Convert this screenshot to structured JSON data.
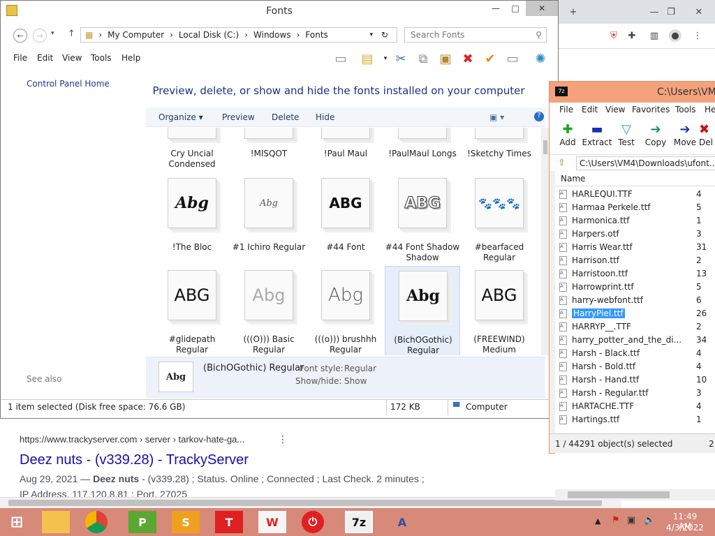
{
  "chrome": {
    "new_tab": "+",
    "minimize": "—",
    "restore": "❐",
    "close": "✕"
  },
  "search_result": {
    "url": "https://www.trackyserver.com › server › tarkov-hate-ga...",
    "more": "⋮",
    "title": "Deez nuts - (v339.28) - TrackyServer",
    "snippet_date": "Aug 29, 2021 — ",
    "snippet_bold": "Deez nuts",
    "snippet_rest": " - (v339.28) ; Status. Online ; Connected ; Last Check. 2 minutes ;",
    "snippet2": "IP Address. 117.120.8.81 ; Port. 27025"
  },
  "explorer": {
    "title": "Fonts",
    "win_min": "—",
    "win_max": "□",
    "win_close": "✕",
    "breadcrumb": [
      "My Computer",
      "Local Disk (C:)",
      "Windows",
      "Fonts"
    ],
    "search_placeholder": "Search Fonts",
    "menu": [
      "File",
      "Edit",
      "View",
      "Tools",
      "Help"
    ],
    "control_panel_home": "Control Panel Home",
    "see_also": "See also",
    "heading": "Preview, delete, or show and hide the fonts installed on your computer",
    "commands": {
      "organize": "Organize ▾",
      "preview": "Preview",
      "delete": "Delete",
      "hide": "Hide"
    },
    "top_row": [
      "Cry Uncial Condensed",
      "!MISQOT",
      "!Paul Maul",
      "!PaulMaul Longs",
      "!Sketchy Times"
    ],
    "row2": [
      {
        "name": "!The Bloc",
        "sample": "Abg"
      },
      {
        "name": "#1 Ichiro Regular",
        "sample": "Abg"
      },
      {
        "name": "#44 Font",
        "sample": "ABG"
      },
      {
        "name": "#44 Font Shadow Shadow",
        "sample": "ABG"
      },
      {
        "name": "#bearfaced Regular",
        "sample": "🐾🐾🐾"
      }
    ],
    "row3": [
      {
        "name": "#glidepath Regular",
        "sample": "ABG"
      },
      {
        "name": "(((O))) Basic Regular",
        "sample": "Abg"
      },
      {
        "name": "(((o))) brushhh Regular",
        "sample": "Abg"
      },
      {
        "name": "(BichOGothic) Regular",
        "sample": "Abg"
      },
      {
        "name": "(FREEWIND) Medium",
        "sample": "ABG"
      }
    ],
    "details": {
      "name": "(BichOGothic) Regular",
      "style_label": "Font style:",
      "style_value": "Regular",
      "sh_label": "Show/hide:",
      "sh_value": "Show",
      "sample": "Abg"
    },
    "status": {
      "selected": "1 item selected (Disk free space: 76.6 GB)",
      "size": "172 KB",
      "location": "Computer"
    }
  },
  "zip": {
    "title": "C:\\Users\\VM4",
    "menu": [
      "File",
      "Edit",
      "View",
      "Favorites",
      "Tools",
      "He"
    ],
    "tools": [
      {
        "label": "Add",
        "icon": "✚",
        "color": "#1aa31a"
      },
      {
        "label": "Extract",
        "icon": "▬",
        "color": "#1a2fb0"
      },
      {
        "label": "Test",
        "icon": "▽",
        "color": "#19a8c4"
      },
      {
        "label": "Copy",
        "icon": "➔",
        "color": "#178a78"
      },
      {
        "label": "Move",
        "icon": "➔",
        "color": "#1a2fb0"
      },
      {
        "label": "Del",
        "icon": "✖",
        "color": "#d01010"
      }
    ],
    "path": "C:\\Users\\VM4\\Downloads\\ufont...",
    "col_name": "Name",
    "files": [
      {
        "n": "HARLEQUI.TTF",
        "s": "4"
      },
      {
        "n": "Harmaa Perkele.ttf",
        "s": "5"
      },
      {
        "n": "Harmonica.ttf",
        "s": "1"
      },
      {
        "n": "Harpers.otf",
        "s": "3"
      },
      {
        "n": "Harris Wear.ttf",
        "s": "31"
      },
      {
        "n": "Harrison.ttf",
        "s": "2"
      },
      {
        "n": "Harristoon.ttf",
        "s": "13"
      },
      {
        "n": "Harrowprint.ttf",
        "s": "5"
      },
      {
        "n": "harry-webfont.ttf",
        "s": "6"
      },
      {
        "n": "HarryPiel.ttf",
        "s": "26"
      },
      {
        "n": "HARRYP__.TTF",
        "s": "2"
      },
      {
        "n": "harry_potter_and_the_di...",
        "s": "34"
      },
      {
        "n": "Harsh - Black.ttf",
        "s": "4"
      },
      {
        "n": "Harsh - Bold.ttf",
        "s": "4"
      },
      {
        "n": "Harsh - Hand.ttf",
        "s": "10"
      },
      {
        "n": "Harsh - Regular.ttf",
        "s": "3"
      },
      {
        "n": "HARTACHE.TTF",
        "s": "4"
      },
      {
        "n": "Hartings.ttf",
        "s": "1"
      }
    ],
    "selected_index": 9,
    "status": "1 / 44291 object(s) selected",
    "status2": "2"
  },
  "taskbar": {
    "time": "11:49 AM",
    "date": "4/3/2022",
    "apps": [
      {
        "label": "",
        "bg": "#f2c14e",
        "fg": "#fff"
      },
      {
        "label": "",
        "bg": "#ffffff",
        "fg": "#fff"
      },
      {
        "label": "P",
        "bg": "#5aa832",
        "fg": "#fff"
      },
      {
        "label": "S",
        "bg": "#f0a020",
        "fg": "#fff"
      },
      {
        "label": "T",
        "bg": "#e02020",
        "fg": "#fff"
      },
      {
        "label": "W",
        "bg": "#f5f5f5",
        "fg": "#e02020"
      },
      {
        "label": "⏻",
        "bg": "#e02020",
        "fg": "#fff"
      },
      {
        "label": "7z",
        "bg": "#f0f0f0",
        "fg": "#111"
      },
      {
        "label": "A",
        "bg": "#d7897a",
        "fg": "#2a4fa0"
      }
    ]
  }
}
